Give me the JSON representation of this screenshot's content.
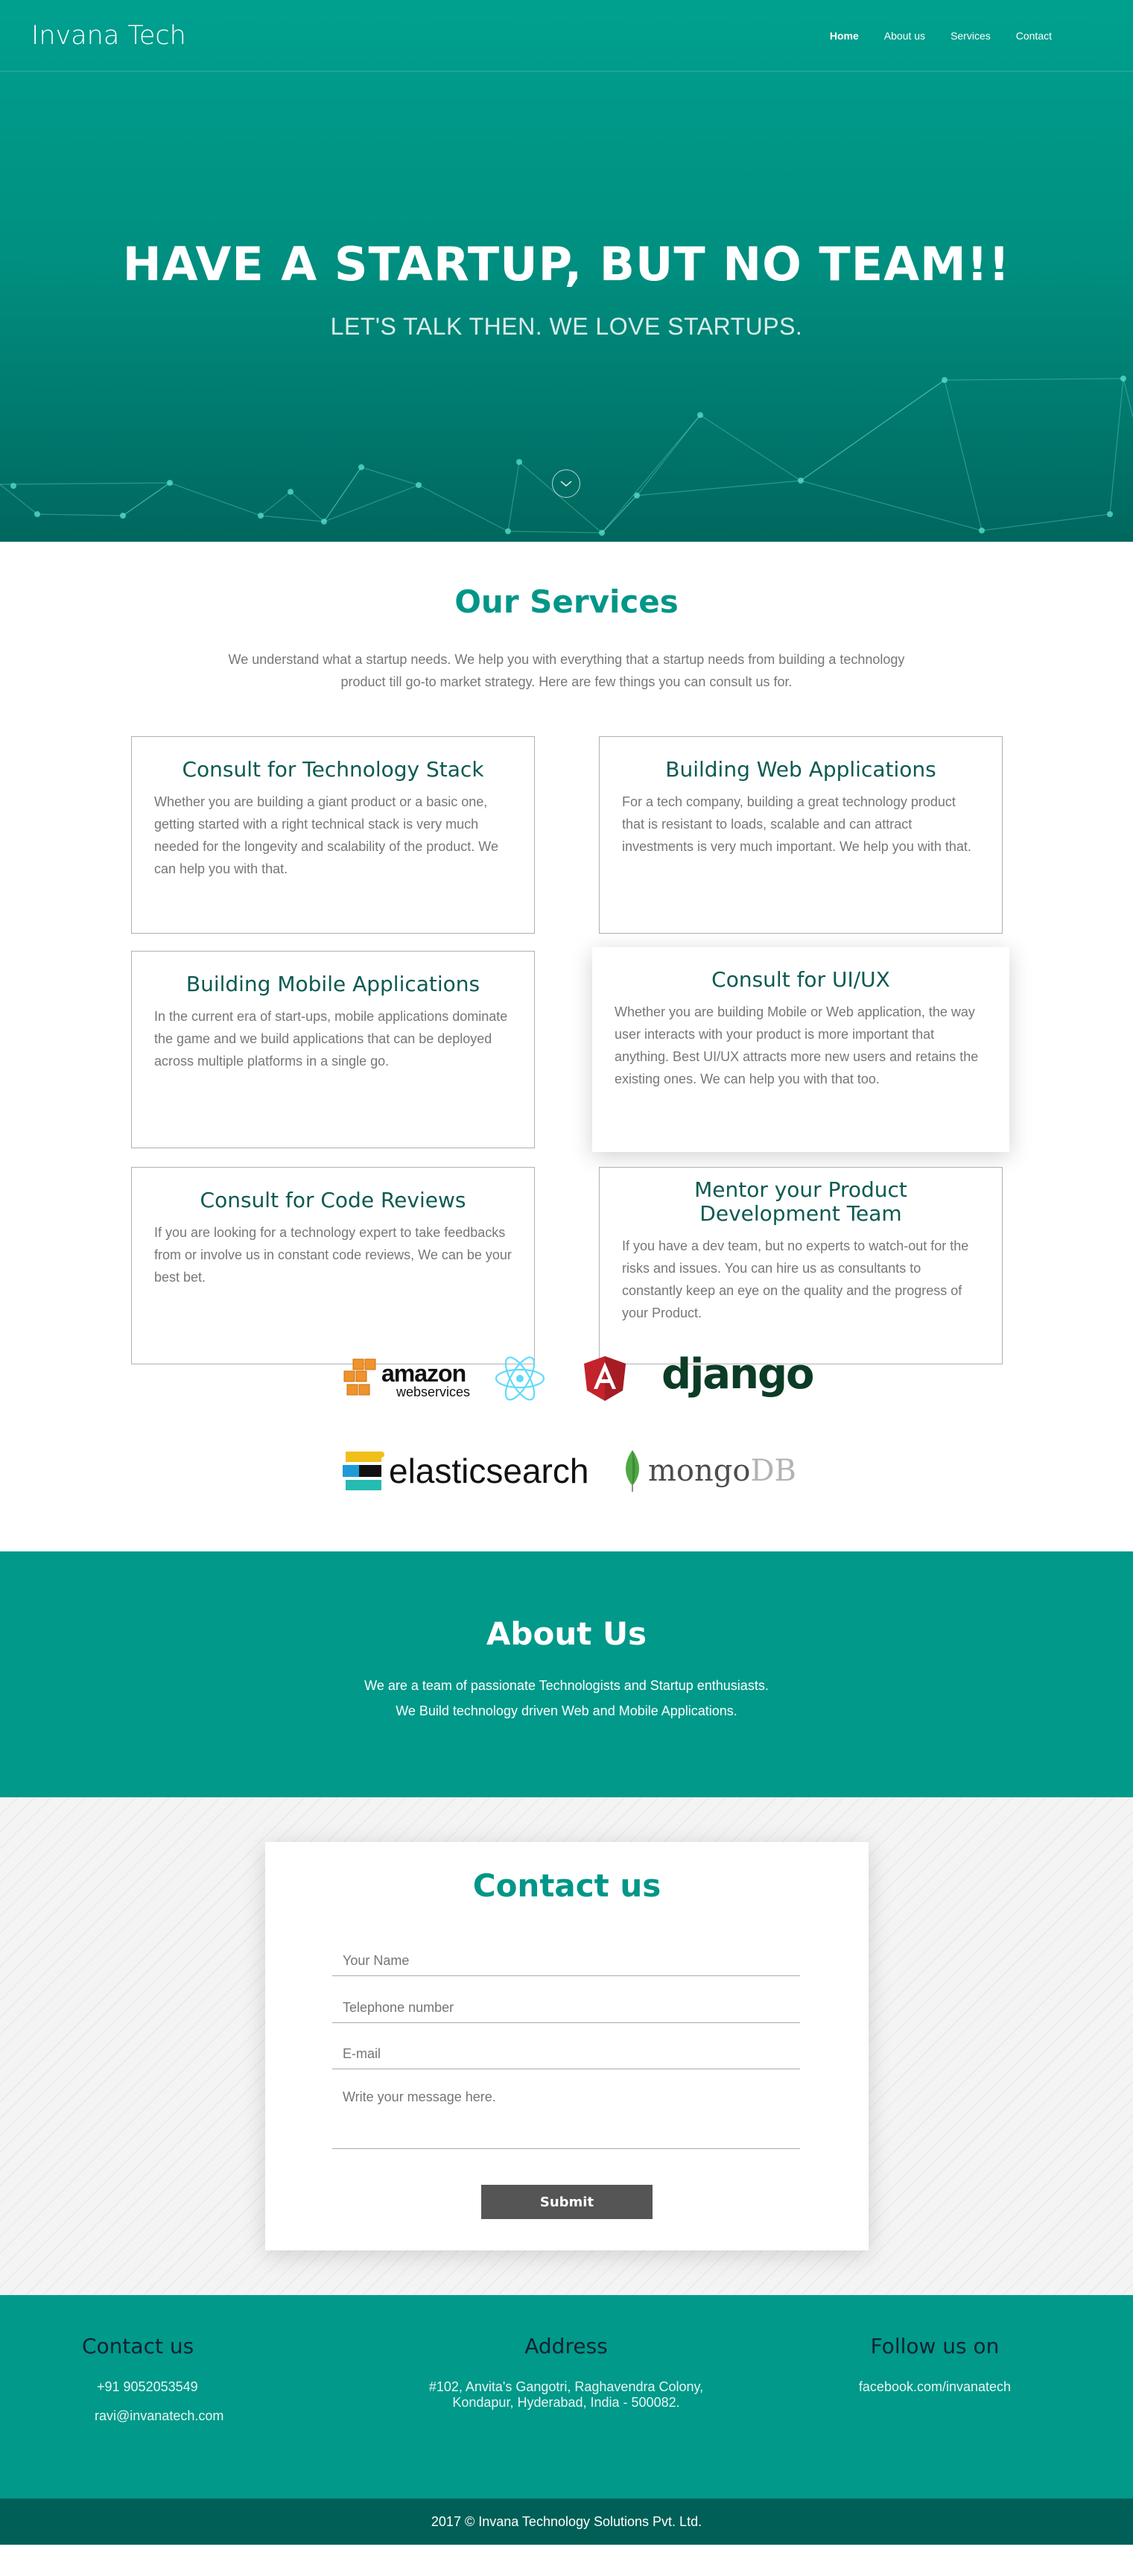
{
  "header": {
    "brand": "Invana Tech",
    "nav": [
      "Home",
      "About us",
      "Services",
      "Contact"
    ]
  },
  "hero": {
    "title": "HAVE A STARTUP, BUT NO TEAM!!",
    "subtitle": "LET'S TALK THEN. WE LOVE STARTUPS.",
    "scroll_icon": "chevron-down-icon"
  },
  "services": {
    "title": "Our Services",
    "intro": "We understand what a startup needs. We help you with everything that a startup needs from building a technology product till go-to market strategy. Here are few things you can consult us for.",
    "cards": [
      {
        "title": "Consult for Technology Stack",
        "text": "Whether you are building a giant product or a basic one, getting started with a right technical stack is very much needed for the longevity and scalability of the product. We can help you with that."
      },
      {
        "title": "Building Web Applications",
        "text": "For a tech company, building a great technology product that is resistant to loads, scalable and can attract investments is very much important. We help you with that."
      },
      {
        "title": "Building Mobile Applications",
        "text": "In the current era of start-ups, mobile applications dominate the game and we build applications that can be deployed across multiple platforms in a single go."
      },
      {
        "title": "Consult for UI/UX",
        "text": "Whether you are building Mobile or Web application, the way user interacts with your product is more important that anything. Best UI/UX attracts more new users and retains the existing ones. We can help you with that too."
      },
      {
        "title": "Consult for Code Reviews",
        "text": "If you are looking for a technology expert to take feedbacks from or involve us in constant code reviews, We can be your best bet."
      },
      {
        "title": "Mentor your Product Development Team",
        "text": "If you have a dev team, but no experts to watch-out for the risks and issues. You can hire us as consultants to constantly keep an eye on the quality and the progress of your Product."
      }
    ]
  },
  "tech_logos": {
    "amazon_line1": "amazon",
    "amazon_line2": "webservices",
    "django": "django",
    "elasticsearch": "elasticsearch",
    "mongo_a": "mongo",
    "mongo_b": "DB"
  },
  "about": {
    "title": "About Us",
    "line1": "We are a team of passionate Technologists and Startup enthusiasts.",
    "line2": "We Build technology driven Web and Mobile Applications."
  },
  "contact": {
    "title": "Contact us",
    "name_placeholder": "Your Name",
    "phone_placeholder": "Telephone number",
    "email_placeholder": "E-mail",
    "message_placeholder": "Write your message here.",
    "submit": "Submit"
  },
  "footer": {
    "contact_title": "Contact us",
    "phone": "+91 9052053549",
    "email": "ravi@invanatech.com",
    "address_title": "Address",
    "address_line1": "#102, Anvita's Gangotri, Raghavendra Colony,",
    "address_line2": "Kondapur, Hyderabad, India - 500082.",
    "follow_title": "Follow us on",
    "facebook": "facebook.com/invanatech",
    "copyright": "2017 © Invana Technology Solutions Pvt. Ltd."
  },
  "colors": {
    "primary": "#009688",
    "footer_dark": "#005f57",
    "card_title": "#0d5a52"
  }
}
